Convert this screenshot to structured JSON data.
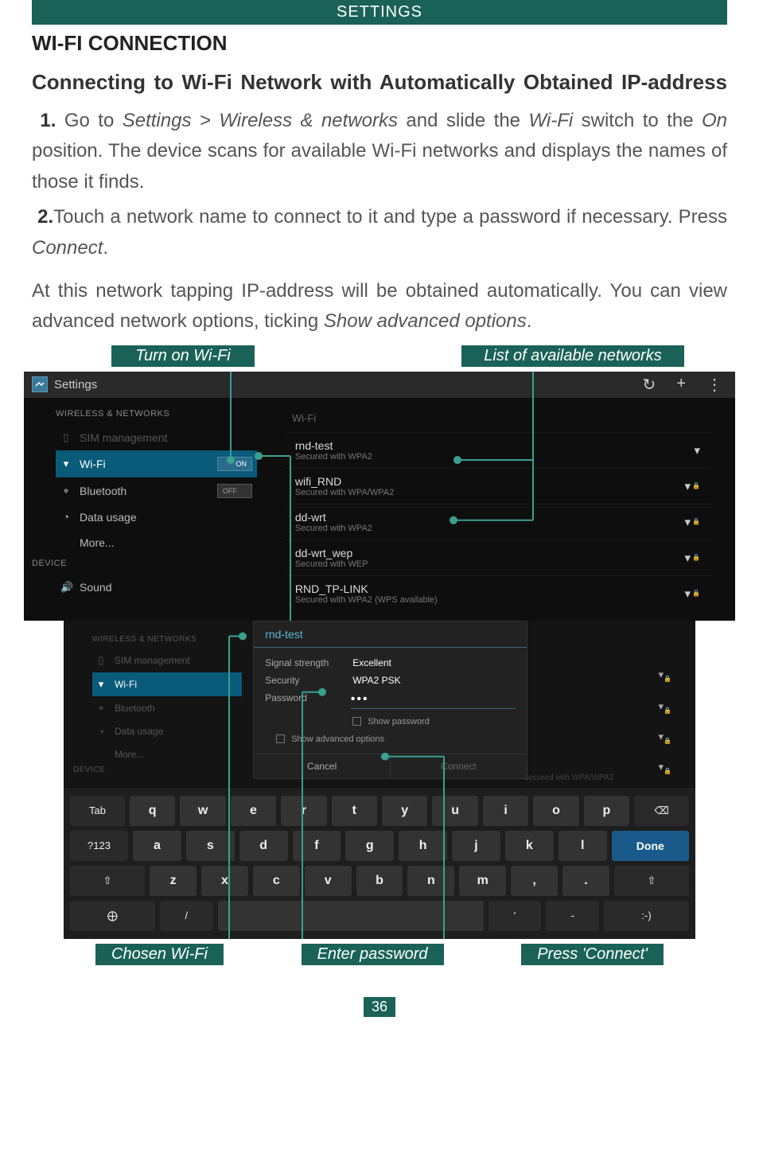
{
  "header": "SETTINGS",
  "section_title": "WI-FI CONNECTION",
  "subtitle": "Connecting to Wi-Fi Network with Automatically Obtained IP-address",
  "step1_num": "1.",
  "step1a": "Go to ",
  "step1b": "Settings > Wireless & networks",
  "step1c": " and slide the ",
  "step1d": "Wi-Fi",
  "step1e": " switch to the ",
  "step1f": "On",
  "step1g": " position. The device scans for available Wi-Fi networks and displays the names of those it finds.",
  "step2_num": "2.",
  "step2a": "Touch a network name to connect to it and type a password if necessary. Press ",
  "step2b": "Connect",
  "step2c": ".",
  "para2a": "At this network tapping IP-address will be obtained automatically. You can view advanced network options, ticking ",
  "para2b": "Show advanced options",
  "para2c": ".",
  "callouts": {
    "turn_on": "Turn on Wi-Fi",
    "list": "List of available networks",
    "chosen": "Chosen Wi-Fi",
    "enter_pwd": "Enter password",
    "press_connect": "Press 'Connect'"
  },
  "ss1": {
    "topbar_title": "Settings",
    "refresh": "↻",
    "plus": "+",
    "menu": "⋮",
    "sidebar": {
      "header1": "WIRELESS & NETWORKS",
      "sim": "SIM management",
      "wifi": "Wi-Fi",
      "wifi_toggle": "ON",
      "bluetooth": "Bluetooth",
      "bt_toggle": "OFF",
      "data": "Data usage",
      "more": "More...",
      "header2": "DEVICE",
      "sound": "Sound"
    },
    "main_header": "Wi-Fi",
    "networks": [
      {
        "name": "rnd-test",
        "sub": "Secured with WPA2"
      },
      {
        "name": "wifi_RND",
        "sub": "Secured with WPA/WPA2"
      },
      {
        "name": "dd-wrt",
        "sub": "Secured with WPA2"
      },
      {
        "name": "dd-wrt_wep",
        "sub": "Secured with WEP"
      },
      {
        "name": "RND_TP-LINK",
        "sub": "Secured with WPA2 (WPS available)"
      }
    ]
  },
  "ss2": {
    "sidebar": {
      "header1": "WIRELESS & NETWORKS",
      "sim": "SIM management",
      "wifi": "Wi-Fi",
      "bluetooth": "Bluetooth",
      "data": "Data usage",
      "more": "More...",
      "header2": "DEVICE"
    },
    "wifi_icons_sub": "Secured with WPA/WPA2",
    "dialog": {
      "title": "rnd-test",
      "signal_lbl": "Signal strength",
      "signal_val": "Excellent",
      "sec_lbl": "Security",
      "sec_val": "WPA2 PSK",
      "pwd_lbl": "Password",
      "pwd_val": "•••",
      "show_pwd": "Show password",
      "show_adv": "Show advanced options",
      "cancel": "Cancel",
      "connect": "Connect"
    },
    "keyboard": {
      "row1": [
        "Tab",
        "q",
        "w",
        "e",
        "r",
        "t",
        "y",
        "u",
        "i",
        "o",
        "p",
        "⌫"
      ],
      "row2": [
        "?123",
        "a",
        "s",
        "d",
        "f",
        "g",
        "h",
        "j",
        "k",
        "l",
        "Done"
      ],
      "row3": [
        "⇧",
        "z",
        "x",
        "c",
        "v",
        "b",
        "n",
        "m",
        ",",
        ".",
        "⇧"
      ],
      "row4_sym": "⨁",
      "row4_slash": "/",
      "row4_space": "",
      "row4_apos": "'",
      "row4_dash": "-",
      "row4_smile": ":-)"
    }
  },
  "page_number": "36"
}
